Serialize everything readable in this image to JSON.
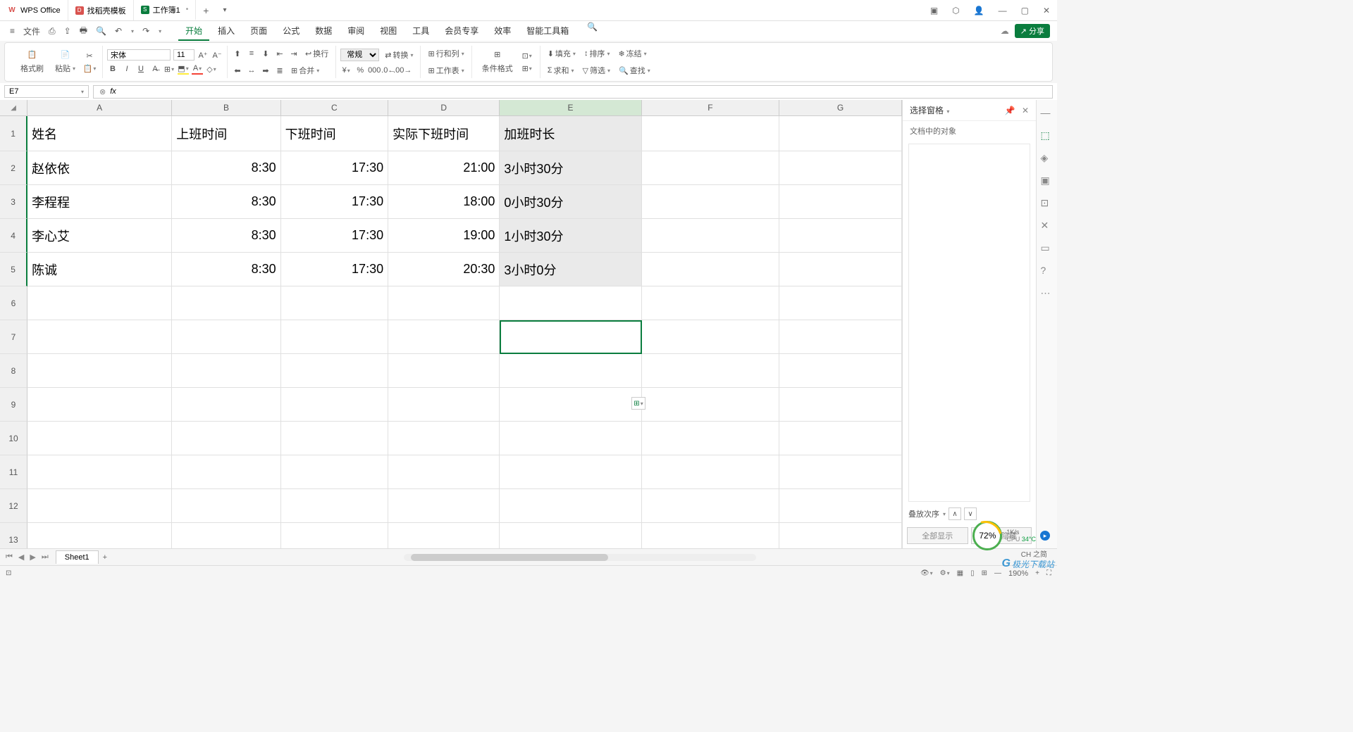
{
  "titleBar": {
    "tabs": [
      {
        "icon": "W",
        "label": "WPS Office"
      },
      {
        "icon": "D",
        "label": "找稻壳模板"
      },
      {
        "icon": "S",
        "label": "工作簿1"
      }
    ]
  },
  "menuBar": {
    "file": "文件",
    "tabs": [
      "开始",
      "插入",
      "页面",
      "公式",
      "数据",
      "审阅",
      "视图",
      "工具",
      "会员专享",
      "效率",
      "智能工具箱"
    ],
    "activeTab": "开始",
    "share": "分享"
  },
  "ribbon": {
    "formatPainter": "格式刷",
    "paste": "粘贴",
    "fontName": "宋体",
    "fontSize": "11",
    "wrap": "换行",
    "general": "常规",
    "convert": "转换",
    "rowcol": "行和列",
    "worksheet": "工作表",
    "condFormat": "条件格式",
    "fill": "填充",
    "sort": "排序",
    "freeze": "冻结",
    "sum": "求和",
    "filter": "筛选",
    "find": "查找",
    "merge": "合并"
  },
  "nameBox": "E7",
  "formulaBar": "",
  "columns": [
    "A",
    "B",
    "C",
    "D",
    "E",
    "F",
    "G"
  ],
  "tableData": {
    "headers": [
      "姓名",
      "上班时间",
      "下班时间",
      "实际下班时间",
      "加班时长"
    ],
    "rows": [
      [
        "赵依依",
        "8:30",
        "17:30",
        "21:00",
        "3小时30分"
      ],
      [
        "李程程",
        "8:30",
        "17:30",
        "18:00",
        "0小时30分"
      ],
      [
        "李心艾",
        "8:30",
        "17:30",
        "19:00",
        "1小时30分"
      ],
      [
        "陈诚",
        "8:30",
        "17:30",
        "20:30",
        "3小时0分"
      ]
    ]
  },
  "rightPanel": {
    "title": "选择窗格",
    "subtitle": "文档中的对象",
    "stackOrder": "叠放次序",
    "showAll": "全部显示",
    "hideAll": "全部隐藏"
  },
  "sheetTab": "Sheet1",
  "statusBar": {
    "zoom": "190%",
    "ime": "CH 之简"
  },
  "sysTray": {
    "percent": "72%",
    "netspeed": "1K/s",
    "cpu": "CPU 34°C"
  },
  "watermark": "极光下载站"
}
